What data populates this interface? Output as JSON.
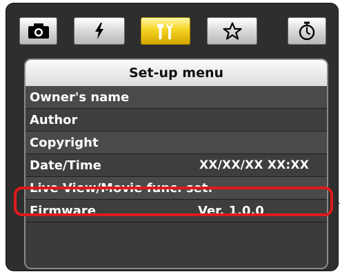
{
  "tabs": [
    {
      "icon": "camera-icon",
      "active": false
    },
    {
      "icon": "flash-icon",
      "active": false
    },
    {
      "icon": "setup-tools-icon",
      "active": true
    },
    {
      "icon": "my-menu-star-icon",
      "active": false
    },
    {
      "icon": "timer-icon",
      "active": false
    }
  ],
  "menu": {
    "title": "Set-up menu",
    "items": [
      {
        "label": "Owner's name",
        "value": ""
      },
      {
        "label": "Author",
        "value": ""
      },
      {
        "label": "Copyright",
        "value": ""
      },
      {
        "label": "Date/Time",
        "value": "XX/XX/XX XX:XX"
      },
      {
        "label": "Live View/Movie func. set.",
        "value": ""
      },
      {
        "label": "Firmware",
        "value": "Ver. 1.0.0"
      }
    ]
  },
  "colors": {
    "active_tab": "#f5d421",
    "highlight": "#e01a1a"
  }
}
